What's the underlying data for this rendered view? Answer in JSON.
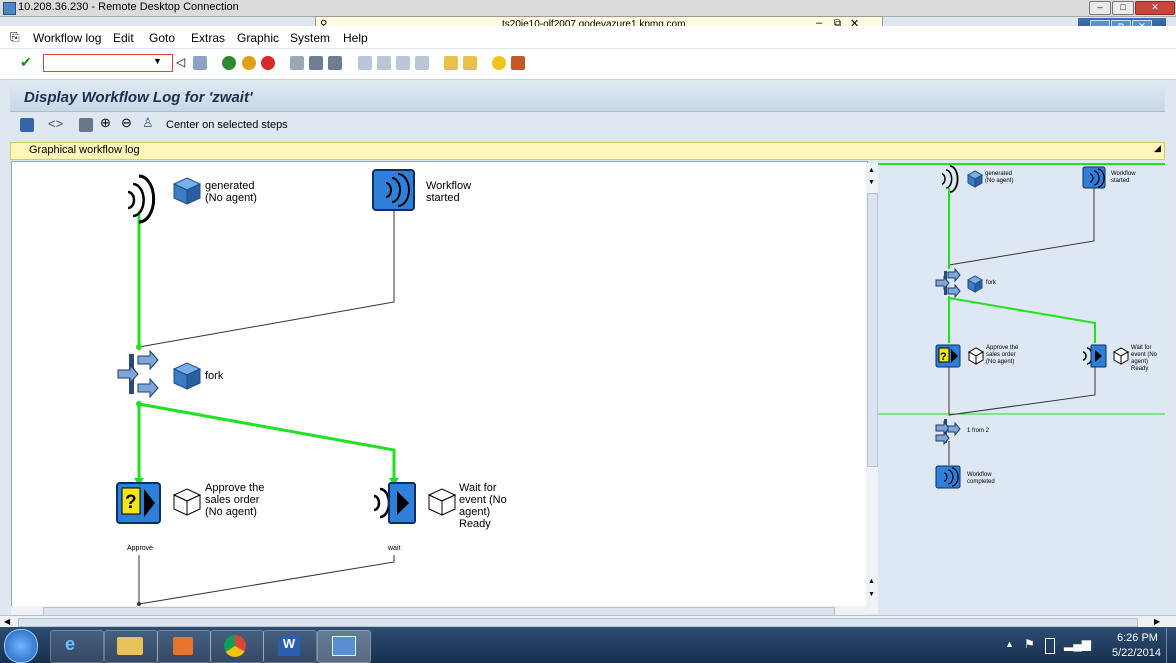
{
  "rdp": {
    "title": "10.208.36.230 - Remote Desktop Connection",
    "host": "ts20ie10-olf2007.godevazure1.kpmg.com"
  },
  "menu": [
    "Workflow log",
    "Edit",
    "Goto",
    "Extras",
    "Graphic",
    "System",
    "Help"
  ],
  "command_field": {
    "value": ""
  },
  "title": "Display Workflow Log for 'zwait'",
  "app_toolbar": {
    "center_label": "Center on selected steps"
  },
  "tab": "Graphical workflow log",
  "graph": {
    "node_generated": "generated (No agent)",
    "node_started": "Workflow started",
    "node_fork": "fork",
    "node_approve": "Approve the sales order (No agent)",
    "node_wait": "Wait for event (No agent) Ready",
    "label_approve": "Approve",
    "label_wait": "wait"
  },
  "overview": {
    "generated": "generated (No agent)",
    "started": "Workflow started",
    "fork": "fork",
    "approve": "Approve the sales order (No agent)",
    "wait": "Wait for event (No agent) Ready",
    "join": "1 from 2",
    "completed": "Workflow completed"
  },
  "taskbar": {
    "time": "6:26 PM",
    "date": "5/22/2014"
  },
  "colors": {
    "flow_active": "#22e122",
    "flow_idle": "#333333",
    "node_blue": "#2f7fd8"
  }
}
